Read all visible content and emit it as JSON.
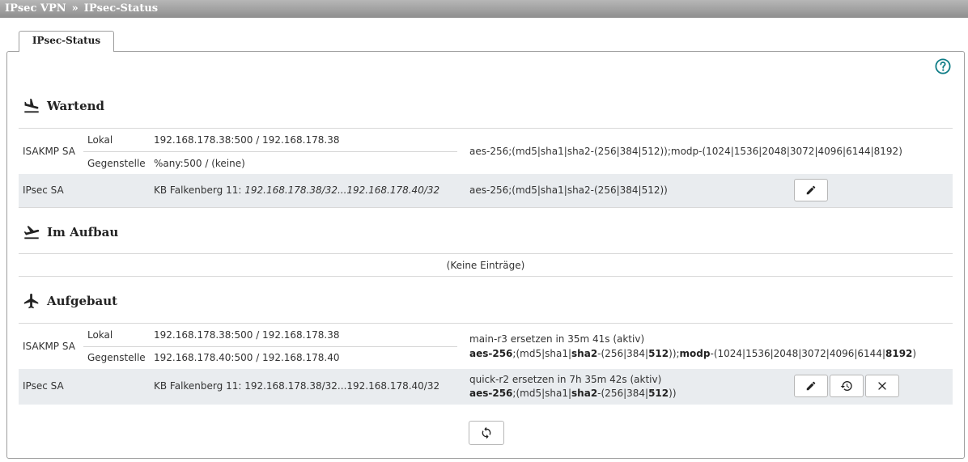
{
  "breadcrumb": {
    "parent": "IPsec VPN",
    "separator": "»",
    "current": "IPsec-Status"
  },
  "tabs": [
    {
      "label": "IPsec-Status",
      "active": true
    }
  ],
  "sections": {
    "wartend": {
      "title": "Wartend",
      "isakmp": {
        "label": "ISAKMP SA",
        "lokal_label": "Lokal",
        "lokal_value": "192.168.178.38:500 / 192.168.178.38",
        "gegenstelle_label": "Gegenstelle",
        "gegenstelle_value": "%any:500 / (keine)",
        "algorithms": "aes-256;(md5|sha1|sha2-(256|384|512));modp-(1024|1536|2048|3072|4096|6144|8192)"
      },
      "ipsec": {
        "label": "IPsec SA",
        "connection_prefix": "KB Falkenberg 11:",
        "connection_network": "192.168.178.38/32...192.168.178.40/32",
        "algorithms": "aes-256;(md5|sha1|sha2-(256|384|512))"
      }
    },
    "im_aufbau": {
      "title": "Im Aufbau",
      "empty_text": "(Keine Einträge)"
    },
    "aufgebaut": {
      "title": "Aufgebaut",
      "isakmp": {
        "label": "ISAKMP SA",
        "lokal_label": "Lokal",
        "lokal_value": "192.168.178.38:500 / 192.168.178.38",
        "gegenstelle_label": "Gegenstelle",
        "gegenstelle_value": "192.168.178.40:500 / 192.168.178.40",
        "status": "main-r3 ersetzen in 35m 41s (aktiv)",
        "alg": {
          "p1": "aes-256",
          "p2": ";(md5|sha1|",
          "p3": "sha2",
          "p4": "-(256|384|",
          "p5": "512",
          "p6": "));",
          "p7": "modp",
          "p8": "-(1024|1536|2048|3072|4096|6144|",
          "p9": "8192",
          "p10": ")"
        }
      },
      "ipsec": {
        "label": "IPsec SA",
        "connection": "KB Falkenberg 11: 192.168.178.38/32...192.168.178.40/32",
        "status": "quick-r2 ersetzen in 7h 35m 42s (aktiv)",
        "alg": {
          "p1": "aes-256",
          "p2": ";(md5|sha1|",
          "p3": "sha2",
          "p4": "-(256|384|",
          "p5": "512",
          "p6": "))"
        }
      }
    }
  },
  "icons": {
    "help": "help-circle-icon",
    "wartend": "airplane-landing-icon",
    "im_aufbau": "airplane-takeoff-icon",
    "aufgebaut": "airplane-icon",
    "edit": "pencil-icon",
    "renew": "history-icon",
    "close": "close-icon",
    "refresh": "refresh-icon"
  },
  "colors": {
    "accent": "#0e7c86",
    "row_grey": "#e9ecef",
    "titlebar": "#9e9e9e"
  }
}
